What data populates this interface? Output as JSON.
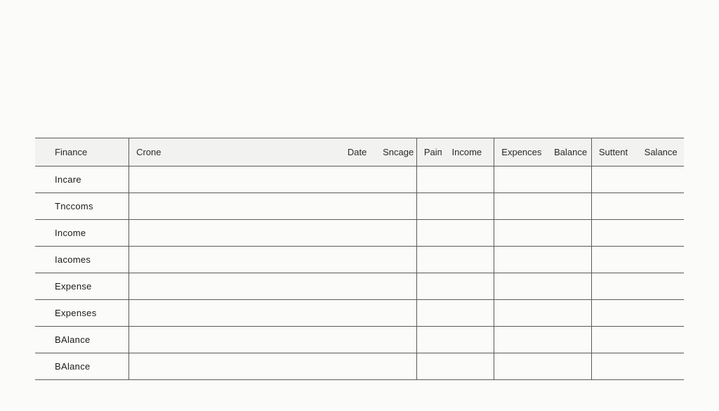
{
  "table": {
    "headers": [
      "Finance",
      "Crone",
      "Date",
      "Sncage",
      "Paiп",
      "Income",
      "Expences",
      "Balance",
      "Suttent",
      "Salance"
    ],
    "rows": [
      {
        "label": "Incare",
        "cells": [
          "",
          "",
          "",
          "",
          "",
          "",
          "",
          "",
          ""
        ]
      },
      {
        "label": "Tnccoms",
        "cells": [
          "",
          "",
          "",
          "",
          "",
          "",
          "",
          "",
          ""
        ]
      },
      {
        "label": "Income",
        "cells": [
          "",
          "",
          "",
          "",
          "",
          "",
          "",
          "",
          ""
        ]
      },
      {
        "label": "Iacomes",
        "cells": [
          "",
          "",
          "",
          "",
          "",
          "",
          "",
          "",
          ""
        ]
      },
      {
        "label": "Expense",
        "cells": [
          "",
          "",
          "",
          "",
          "",
          "",
          "",
          "",
          ""
        ]
      },
      {
        "label": "Expenses",
        "cells": [
          "",
          "",
          "",
          "",
          "",
          "",
          "",
          "",
          ""
        ]
      },
      {
        "label": "BAlance",
        "cells": [
          "",
          "",
          "",
          "",
          "",
          "",
          "",
          "",
          ""
        ]
      },
      {
        "label": "BAlance",
        "cells": [
          "",
          "",
          "",
          "",
          "",
          "",
          "",
          "",
          ""
        ]
      }
    ]
  }
}
